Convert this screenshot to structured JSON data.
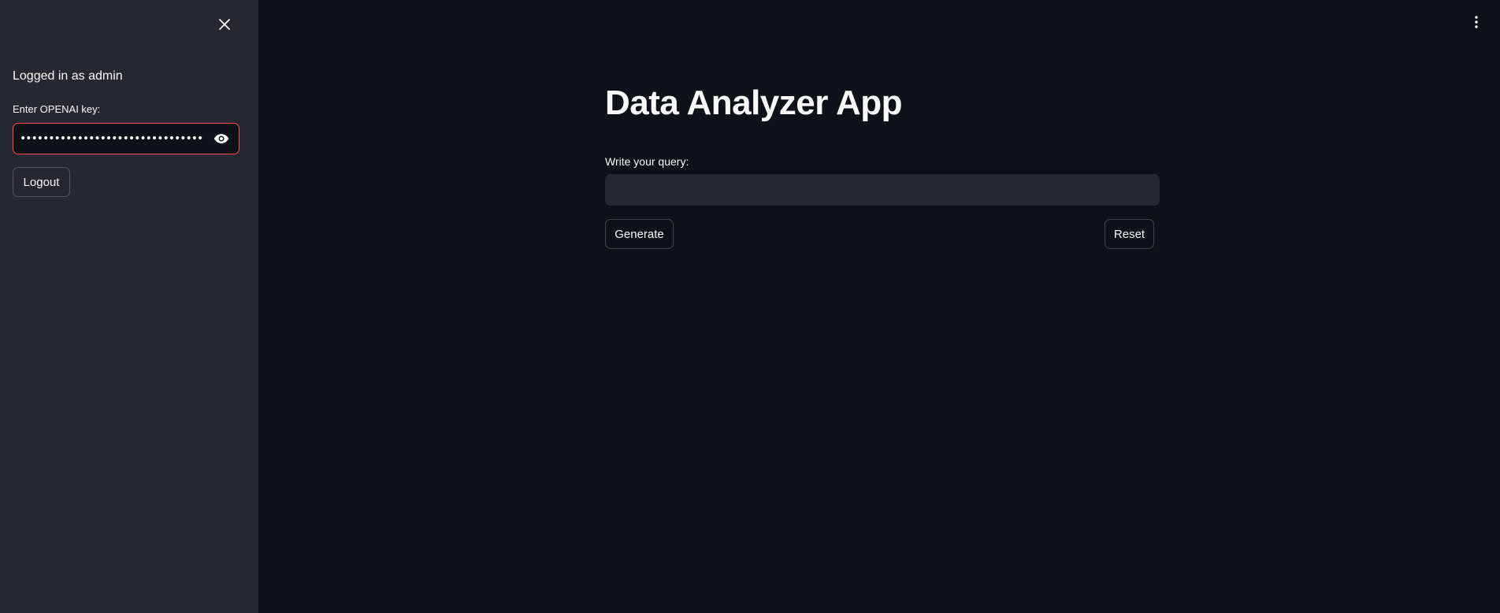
{
  "sidebar": {
    "logged_in_text": "Logged in as admin",
    "key_label": "Enter OPENAI key:",
    "key_value": "•••••••••••••••••••••••••••••••••••••••••••••••••••",
    "logout_label": "Logout"
  },
  "main": {
    "title": "Data Analyzer App",
    "query_label": "Write your query:",
    "query_value": "",
    "generate_label": "Generate",
    "reset_label": "Reset"
  },
  "icons": {
    "close": "close-icon",
    "eye": "eye-icon",
    "menu": "vertical-dots-icon"
  },
  "colors": {
    "background": "#0e1117",
    "sidebar": "#262730",
    "error_border": "#ff4b4b",
    "text": "#fafafa"
  }
}
